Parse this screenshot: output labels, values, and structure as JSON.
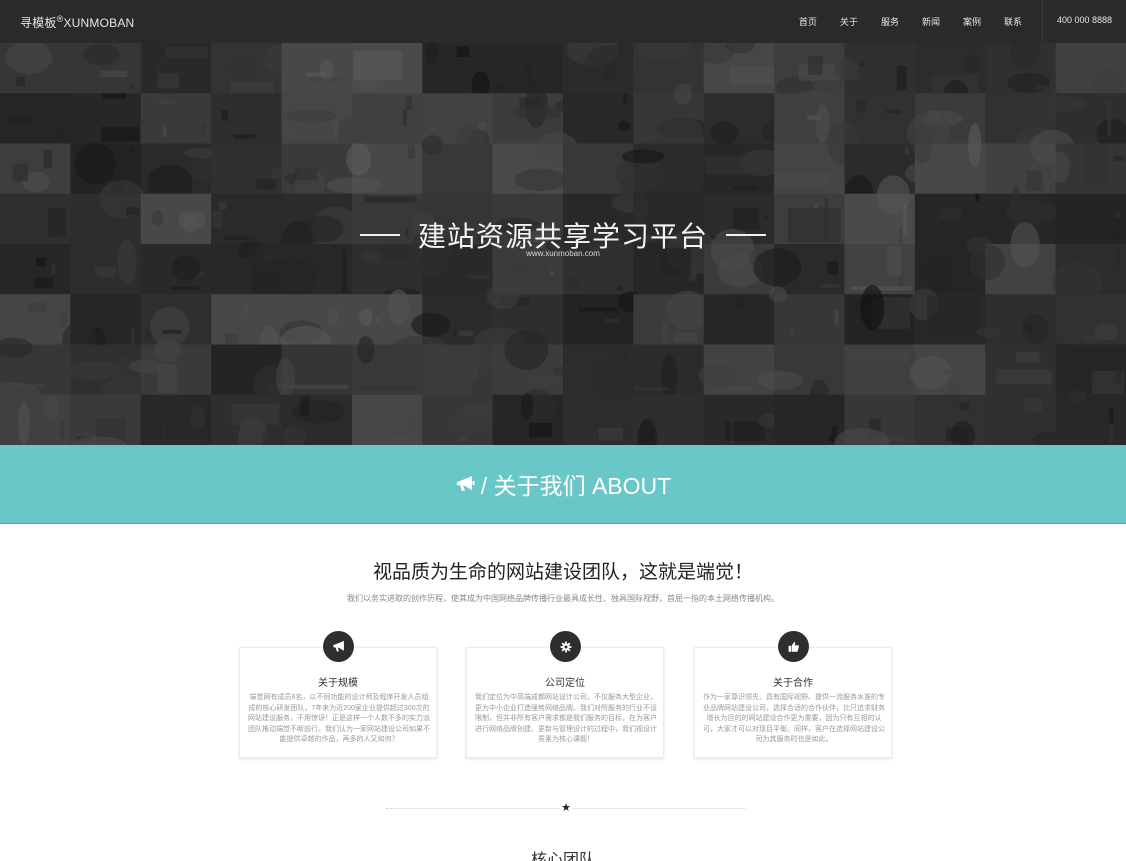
{
  "header": {
    "logo_cn": "寻模板",
    "logo_mark": "®",
    "logo_en": "XUNMOBAN",
    "nav": [
      "首页",
      "关于",
      "服务",
      "新闻",
      "案例",
      "联系"
    ],
    "phone": "400 000 8888"
  },
  "hero": {
    "title": "建站资源共享学习平台",
    "subtitle": "www.xunmoban.com"
  },
  "about_band": {
    "label": "/ 关于我们 ABOUT",
    "icon": "megaphone-icon"
  },
  "about": {
    "headline": "视品质为生命的网站建设团队，这就是端觉！",
    "intro": "我们以务实进取的创作历程，使其成为中国网络品牌传播行业最具成长性、独具国际视野，首屈一指的本土网络传播机构。",
    "cards": [
      {
        "icon": "megaphone-icon",
        "title": "关于规模",
        "text": "端觉网有成员8名，以不同功能的设计师及程序开发人员组成的核心研发团队，7年来为近200家企业提供超过300次的网站建设服务，不用惊讶！正是这样一个人数不多的实力派团队推动端觉不断前行。我们认为一家网站建设公司如果不能提供卓越的作品，再多的人又如何？"
      },
      {
        "icon": "gear-icon",
        "title": "公司定位",
        "text": "我们定位为中高端成都网站设计公司，不仅服务大型企业，更为中小企业打造强势网络品牌。我们对所服务的行业不设限制，但并非所有客户需求都是我们服务的目标，在为客户进行网络品牌创建、更新与管理设计的过程中，我们视设计质素为核心课题！"
      },
      {
        "icon": "thumbs-up-icon",
        "title": "关于合作",
        "text": "作为一家尊识领先、具有国际视野、提供一流服务水准的专业品牌网站建设公司，选择合适的合作伙伴，比只追求财务增长为目的的网站建设合作更为重要，因为只有互相的认可，大家才可以对现目平衡。同样，客户在选择网站建设公司为其服务时也是如此。"
      }
    ]
  },
  "divider": {
    "symbol": "★"
  },
  "team": {
    "title": "核心团队"
  },
  "colors": {
    "topbar": "#2a2a2a",
    "band": "#69c8c7",
    "icon_circle": "#2e2e2e"
  }
}
